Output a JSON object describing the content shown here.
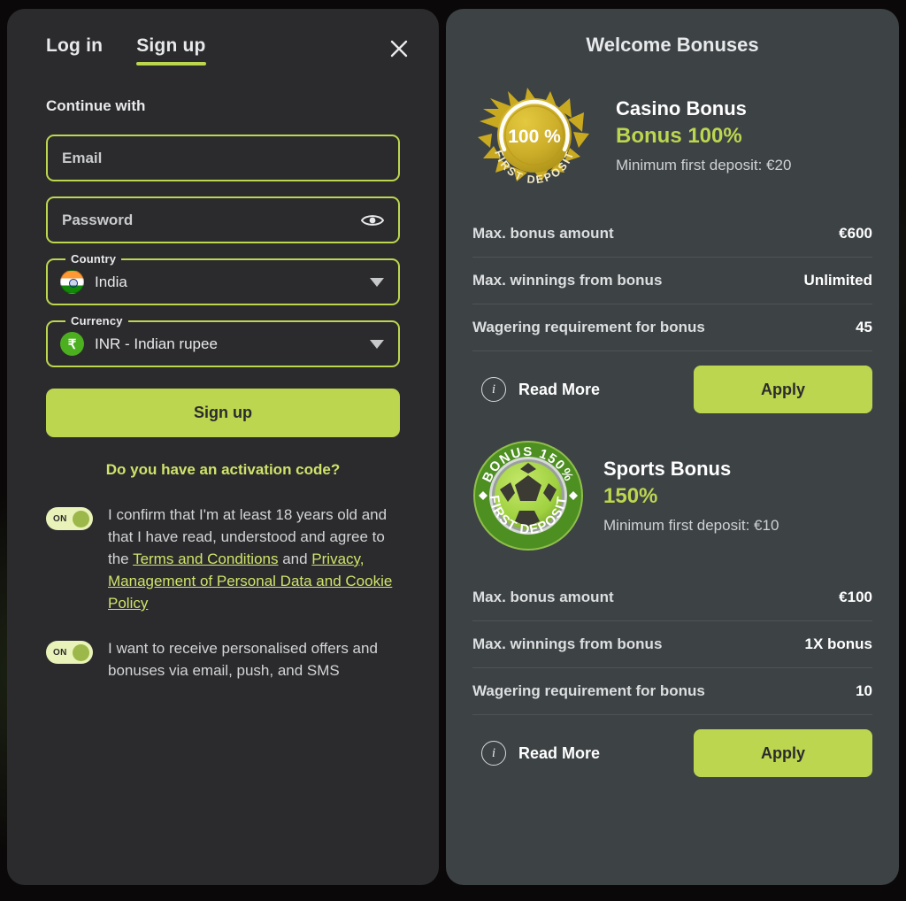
{
  "auth": {
    "tabs": [
      {
        "label": "Log in",
        "active": false
      },
      {
        "label": "Sign up",
        "active": true
      }
    ],
    "close_icon": "close-icon",
    "continue_with_label": "Continue with",
    "email": {
      "placeholder": "Email",
      "value": ""
    },
    "password": {
      "placeholder": "Password",
      "value": "",
      "reveal_icon": "eye-icon"
    },
    "country": {
      "legend": "Country",
      "value": "India",
      "flag": "india-flag-icon",
      "caret": "chevron-down-icon"
    },
    "currency": {
      "legend": "Currency",
      "value": "INR - Indian rupee",
      "symbol": "₹",
      "caret": "chevron-down-icon"
    },
    "submit_label": "Sign up",
    "activation_code_link": "Do you have an activation code?",
    "consents": [
      {
        "toggle_label": "ON",
        "state": "on",
        "text_parts": [
          {
            "t": "I confirm that I'm at least 18 years old and that I have read, understood and agree to the ",
            "link": false
          },
          {
            "t": "Terms and Conditions",
            "link": true
          },
          {
            "t": " and ",
            "link": false
          },
          {
            "t": "Privacy, Management of Personal Data and Cookie Policy",
            "link": true
          }
        ]
      },
      {
        "toggle_label": "ON",
        "state": "on",
        "text_parts": [
          {
            "t": "I want to receive personalised offers and bonuses via email, push, and SMS",
            "link": false
          }
        ]
      }
    ]
  },
  "bonuses": {
    "title": "Welcome Bonuses",
    "items": [
      {
        "badge": {
          "kind": "gold-medal-icon",
          "center_text": "100 %",
          "ring_text": "FIRST DEPOSIT"
        },
        "name": "Casino Bonus",
        "percent": "Bonus 100%",
        "min_deposit": "Minimum first deposit: €20",
        "specs": [
          {
            "key": "Max. bonus amount",
            "value": "€600"
          },
          {
            "key": "Max. winnings from bonus",
            "value": "Unlimited"
          },
          {
            "key": "Wagering requirement for bonus",
            "value": "45"
          }
        ],
        "read_more_label": "Read More",
        "read_more_icon": "info-icon",
        "apply_label": "Apply"
      },
      {
        "badge": {
          "kind": "soccer-ball-icon",
          "top_ring_text": "BONUS 150%",
          "ring_text": "FIRST DEPOSIT"
        },
        "name": "Sports Bonus",
        "percent": "150%",
        "min_deposit": "Minimum first deposit: €10",
        "specs": [
          {
            "key": "Max. bonus amount",
            "value": "€100"
          },
          {
            "key": "Max. winnings from bonus",
            "value": "1X bonus"
          },
          {
            "key": "Wagering requirement for bonus",
            "value": "10"
          }
        ],
        "read_more_label": "Read More",
        "read_more_icon": "info-icon",
        "apply_label": "Apply"
      }
    ]
  },
  "colors": {
    "accent_green": "#bcd64f",
    "link_green": "#cfe36b",
    "panel_left_bg": "#2b2b2d",
    "panel_right_bg": "#3d4245",
    "page_bg": "#0a0808",
    "text_primary": "#e8e9ea",
    "text_secondary": "#cfd1d2"
  }
}
